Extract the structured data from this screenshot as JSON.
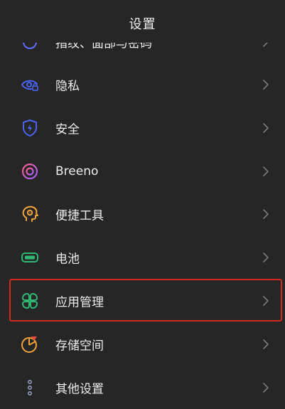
{
  "header": {
    "title": "设置"
  },
  "colors": {
    "background": "#262626",
    "text": "#ececec",
    "chevron": "#7a7a7a",
    "highlight": "#d2281f"
  },
  "items": [
    {
      "label": "指纹、面部与密码",
      "icon": "fingerprint-icon",
      "color": "#5f6cff"
    },
    {
      "label": "隐私",
      "icon": "privacy-eye-icon",
      "color": "#4b63f5"
    },
    {
      "label": "安全",
      "icon": "shield-bolt-icon",
      "color": "#4b63f5"
    },
    {
      "label": "Breeno",
      "icon": "breeno-ring-icon",
      "color": "#c05ef0"
    },
    {
      "label": "便捷工具",
      "icon": "head-gear-icon",
      "color": "#f2a23a"
    },
    {
      "label": "电池",
      "icon": "battery-icon",
      "color": "#2fb874"
    },
    {
      "label": "应用管理",
      "icon": "app-grid-icon",
      "color": "#2fb874"
    },
    {
      "label": "存储空间",
      "icon": "pie-chart-icon",
      "color": "#f2a23a"
    },
    {
      "label": "其他设置",
      "icon": "more-dots-icon",
      "color": "#8e9bb8"
    }
  ]
}
